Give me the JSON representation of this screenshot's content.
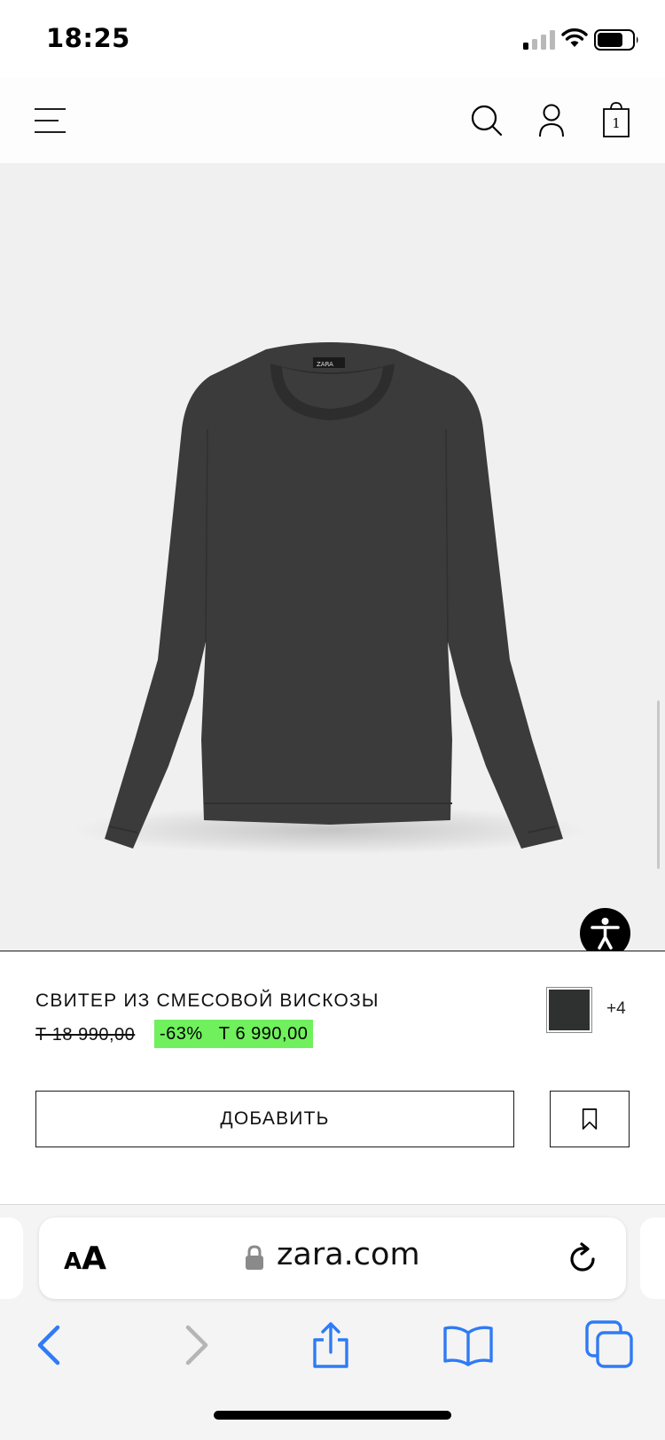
{
  "status_bar": {
    "time": "18:25"
  },
  "header": {
    "icons": [
      "menu-icon",
      "search-icon",
      "account-icon",
      "bag-icon"
    ],
    "cart_count": "1"
  },
  "product": {
    "name": "СВИТЕР ИЗ СМЕСОВОЙ ВИСКОЗЫ",
    "old_price": "Т 18 990,00",
    "discount": "-63%",
    "sale_price": "Т 6 990,00",
    "more_colors": "+4",
    "swatch_color": "#2f3130",
    "sweater_color": "#3a3b3a",
    "add_label": "ДОБАВИТЬ"
  },
  "colors": {
    "sale_highlight": "#6ff05c",
    "ios_blue": "#2f7bf5"
  },
  "browser": {
    "text_size_small": "A",
    "text_size_big": "A",
    "url": "zara.com",
    "toolbar_icons": [
      "back-icon",
      "forward-icon",
      "share-icon",
      "bookmarks-icon",
      "tabs-icon"
    ]
  }
}
